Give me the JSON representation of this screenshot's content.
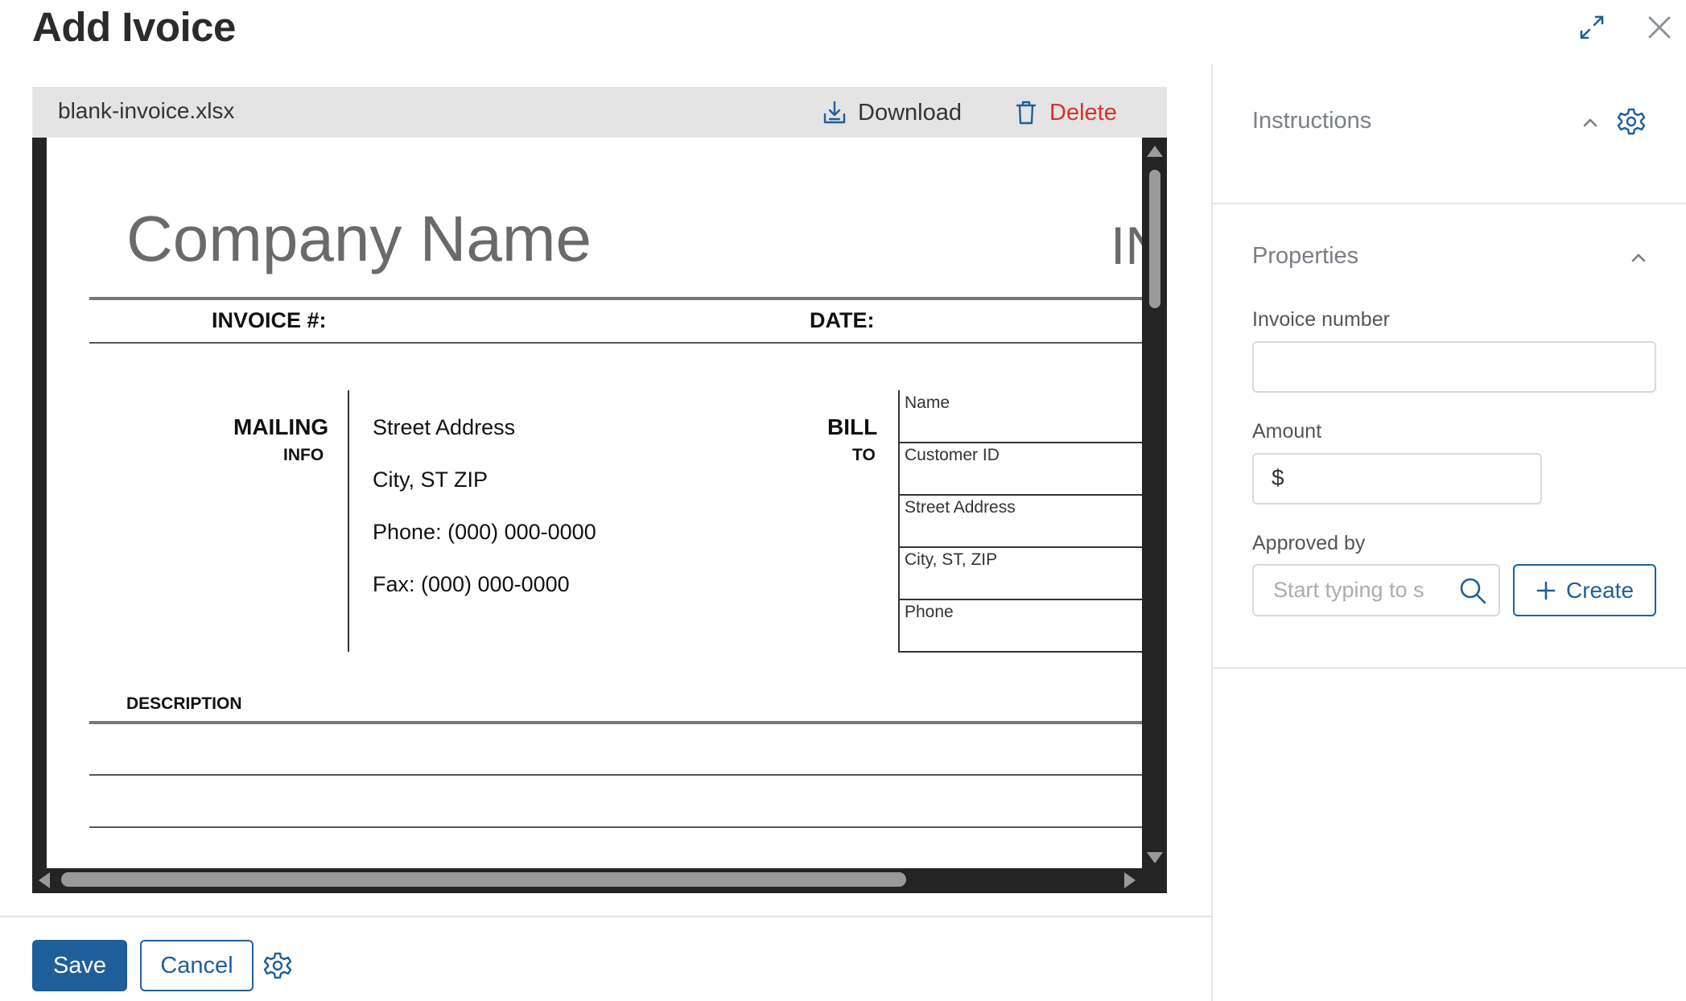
{
  "header": {
    "title": "Add Ivoice",
    "icons": [
      "expand-icon",
      "close-icon"
    ]
  },
  "file": {
    "name": "blank-invoice.xlsx",
    "download_label": "Download",
    "delete_label": "Delete"
  },
  "sheet": {
    "company": "Company Name",
    "company_right_fragment": "IN",
    "invoice_label": "INVOICE #:",
    "date_label": "DATE:",
    "mailing_label": "MAILING",
    "mailing_sub": "INFO",
    "street": "Street Address",
    "city": "City, ST  ZIP",
    "phone": "Phone: (000) 000-0000",
    "fax": "Fax: (000) 000-0000",
    "bill_label": "BILL",
    "bill_sub": "TO",
    "bill_fields": [
      "Name",
      "Customer ID",
      "Street Address",
      "City, ST, ZIP",
      "Phone"
    ],
    "description_label": "DESCRIPTION"
  },
  "panel": {
    "instructions_title": "Instructions",
    "properties_title": "Properties",
    "invoice_number_label": "Invoice number",
    "invoice_number_value": "",
    "amount_label": "Amount",
    "amount_prefix": "$",
    "amount_value": "",
    "approved_by_label": "Approved by",
    "approved_by_placeholder": "Start typing to s",
    "create_label": "Create"
  },
  "footer": {
    "save_label": "Save",
    "cancel_label": "Cancel"
  },
  "colors": {
    "accent": "#1f5f99",
    "danger": "#d9302a",
    "viewer_bg": "#242424"
  }
}
